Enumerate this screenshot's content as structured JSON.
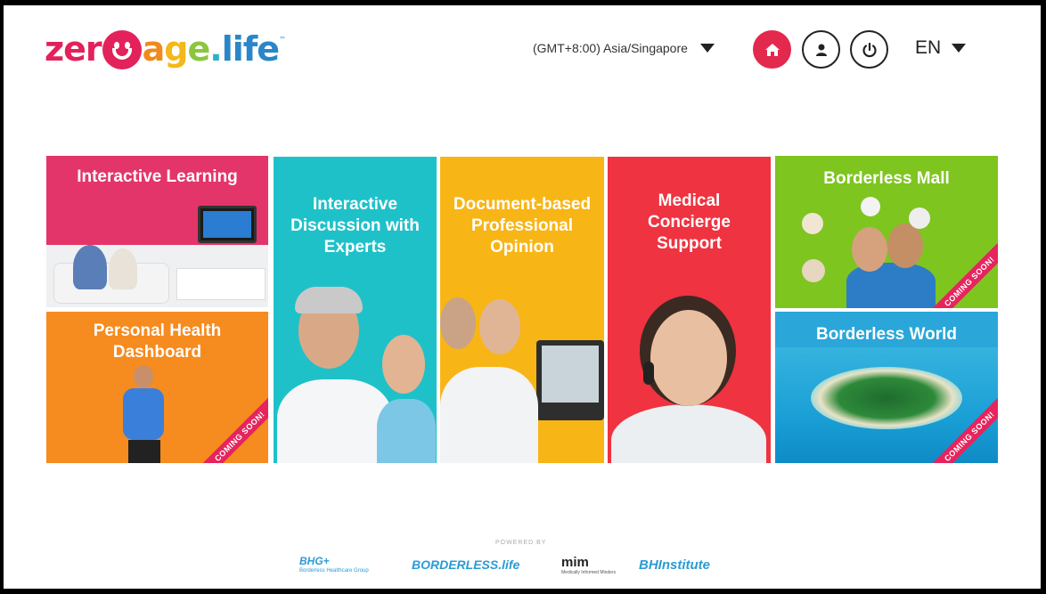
{
  "header": {
    "logo": {
      "p1": "zer",
      "p2": "a",
      "p3": "g",
      "p4": "e",
      "p5": ".",
      "p6": "life",
      "tm": "™"
    },
    "timezone": "(GMT+8:00) Asia/Singapore",
    "language": "EN",
    "icons": {
      "home": "home-icon",
      "user": "user-icon",
      "power": "power-icon",
      "caret": "chevron-down-icon"
    }
  },
  "tiles": [
    {
      "title": "Interactive Learning"
    },
    {
      "title": "Personal Health Dashboard",
      "ribbon": "COMING SOON!"
    },
    {
      "title": "Interactive Discussion with Experts"
    },
    {
      "title": "Document-based Professional Opinion"
    },
    {
      "title": "Medical Concierge Support"
    },
    {
      "title": "Borderless Mall",
      "ribbon": "COMING SOON!"
    },
    {
      "title": "Borderless World",
      "ribbon": "COMING SOON!"
    }
  ],
  "footer": {
    "powered_by": "POWERED BY",
    "logos": [
      {
        "name": "BHG+",
        "sub": "Borderless Healthcare Group"
      },
      {
        "name": "BORDERLESS.life"
      },
      {
        "name": "mim",
        "sub": "Medically Informed Minders"
      },
      {
        "name": "BHInstitute"
      }
    ]
  },
  "colors": {
    "brand_red": "#e3294d",
    "tile_pink": "#e3356a",
    "tile_orange": "#f68b1f",
    "tile_teal": "#1fc1c9",
    "tile_yellow": "#f8b516",
    "tile_red": "#ef3340",
    "tile_green": "#7ec520",
    "tile_blue": "#2aa6d9"
  }
}
